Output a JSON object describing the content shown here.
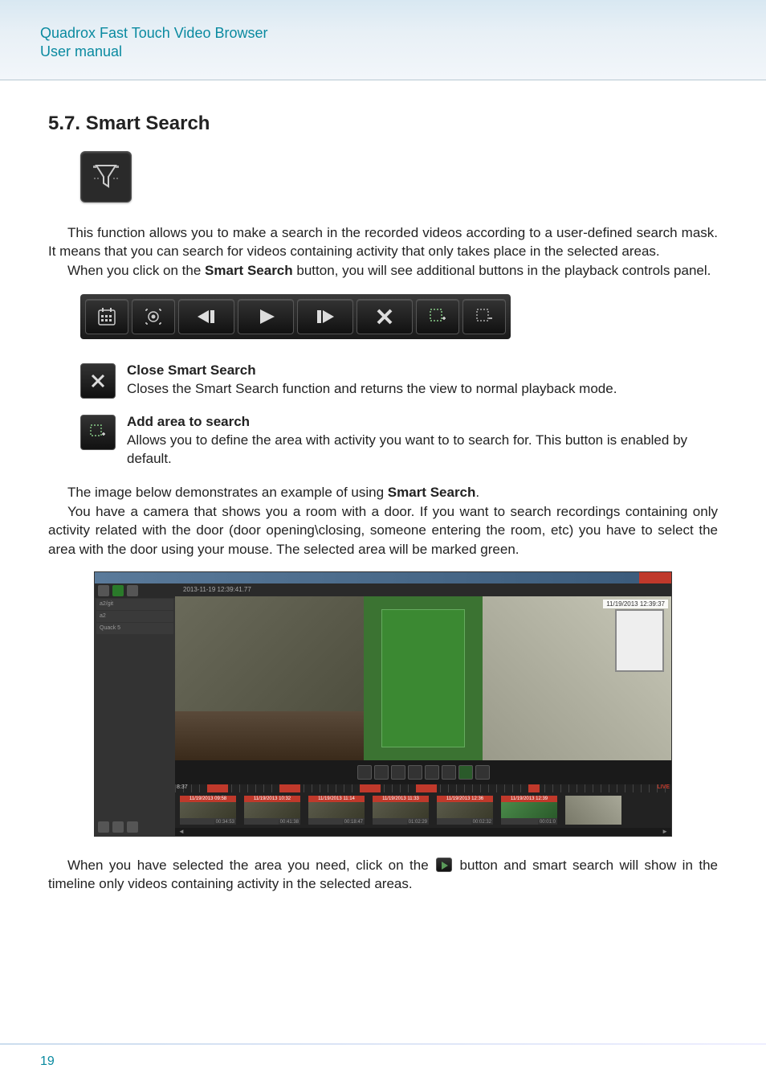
{
  "header": {
    "product": "Quadrox Fast Touch Video Browser",
    "subtitle": "User manual"
  },
  "section": {
    "number": "5.7.",
    "title": "Smart Search"
  },
  "intro": {
    "p1": "This function allows you to make a search in the recorded videos according to a user-defined search mask. It means that you can search for videos containing activity that only takes place in the selected areas.",
    "p2_pre": "When you click on the ",
    "p2_bold": "Smart Search",
    "p2_post": " button, you will see additional buttons in the playback controls panel."
  },
  "toolbar": {
    "buttons": [
      {
        "name": "calendar-icon"
      },
      {
        "name": "camera-view-icon"
      },
      {
        "name": "step-back-icon"
      },
      {
        "name": "play-icon"
      },
      {
        "name": "step-forward-icon"
      },
      {
        "name": "close-x-icon"
      },
      {
        "name": "add-area-icon"
      },
      {
        "name": "remove-area-icon"
      }
    ]
  },
  "features": {
    "close": {
      "title": "Close Smart Search",
      "desc": "Closes the Smart Search function and returns the view to normal playback mode."
    },
    "add": {
      "title": "Add area to search",
      "desc": "Allows you to define the area with activity you want to to search for. This button is enabled by default."
    }
  },
  "example": {
    "p1_pre": "The image below demonstrates an example of using ",
    "p1_bold": "Smart Search",
    "p1_post": ".",
    "p2": "You have a camera that shows you a room with a door. If you want to search recordings containing only activity related with the door (door opening\\closing, someone entering the room, etc) you have to select the area with the door using your mouse. The selected area will be marked green."
  },
  "screenshot": {
    "timestamp_bar": "2013-11-19 12:39:41.77",
    "overlay_ts": "11/19/2013 12:39:37",
    "sidebar_items": [
      "a2/git",
      "a2",
      "Quack 5"
    ],
    "live_label": "LIVE",
    "ruler_start": "8:37",
    "thumbs": [
      {
        "label": "11/19/2013 09:58",
        "dur": "00:34:53"
      },
      {
        "label": "11/19/2013 10:32",
        "dur": "00:41:38"
      },
      {
        "label": "11/19/2013 11:14",
        "dur": "00:18:47"
      },
      {
        "label": "11/19/2013 11:33",
        "dur": "01:02:29"
      },
      {
        "label": "11/19/2013 12:36",
        "dur": "00:02:32"
      },
      {
        "label": "11/19/2013 12:39",
        "dur": "00:01:0"
      }
    ]
  },
  "closing": {
    "pre": "When you have selected the area you need, click on the ",
    "post": " button and smart search will show in the timeline only videos containing activity in the selected areas."
  },
  "page_number": "19"
}
